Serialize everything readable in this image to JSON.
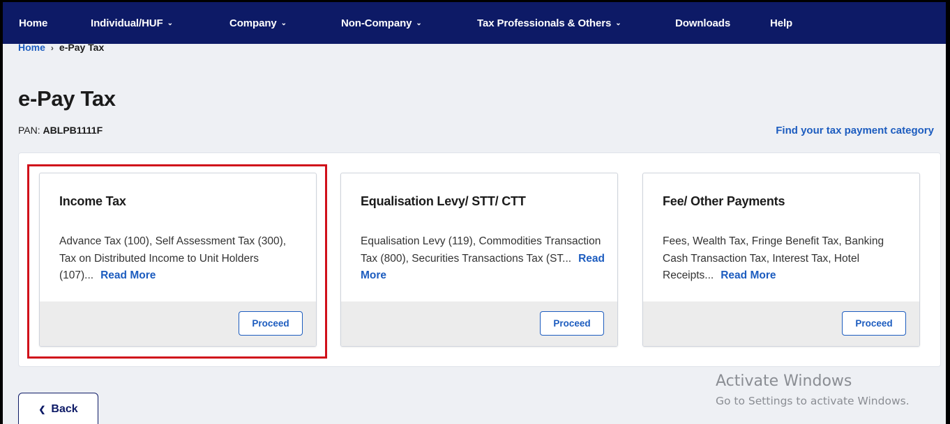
{
  "nav": {
    "home": "Home",
    "individual": "Individual/HUF",
    "company": "Company",
    "non_company": "Non-Company",
    "tax_professionals": "Tax Professionals & Others",
    "downloads": "Downloads",
    "help": "Help",
    "chevron_icon": "chevron-down-icon"
  },
  "breadcrumb": {
    "home": "Home",
    "separator": "›",
    "current": "e-Pay Tax"
  },
  "page": {
    "title": "e-Pay Tax",
    "pan_label": "PAN: ",
    "pan_value": "ABLPB1111F",
    "find_category_link": "Find your tax payment category"
  },
  "cards": [
    {
      "title": "Income Tax",
      "description": "Advance Tax (100), Self Assessment Tax (300), Tax on Distributed Income to Unit Holders (107)...",
      "read_more": "Read More",
      "proceed": "Proceed",
      "highlighted": true
    },
    {
      "title": "Equalisation Levy/ STT/ CTT",
      "description": "Equalisation Levy (119), Commodities Transaction Tax (800), Securities Transactions Tax (ST...",
      "read_more": "Read More",
      "proceed": "Proceed",
      "highlighted": false
    },
    {
      "title": "Fee/ Other Payments",
      "description": "Fees, Wealth Tax, Fringe Benefit Tax, Banking Cash Transaction Tax, Interest Tax, Hotel Receipts...",
      "read_more": "Read More",
      "proceed": "Proceed",
      "highlighted": false
    }
  ],
  "back_button": "Back",
  "watermark": {
    "line1": "Activate Windows",
    "line2": "Go to Settings to activate Windows."
  },
  "colors": {
    "nav_bg": "#0d1a66",
    "link": "#1c5cbf",
    "highlight": "#d0101a",
    "footer_bg": "#ececec"
  }
}
